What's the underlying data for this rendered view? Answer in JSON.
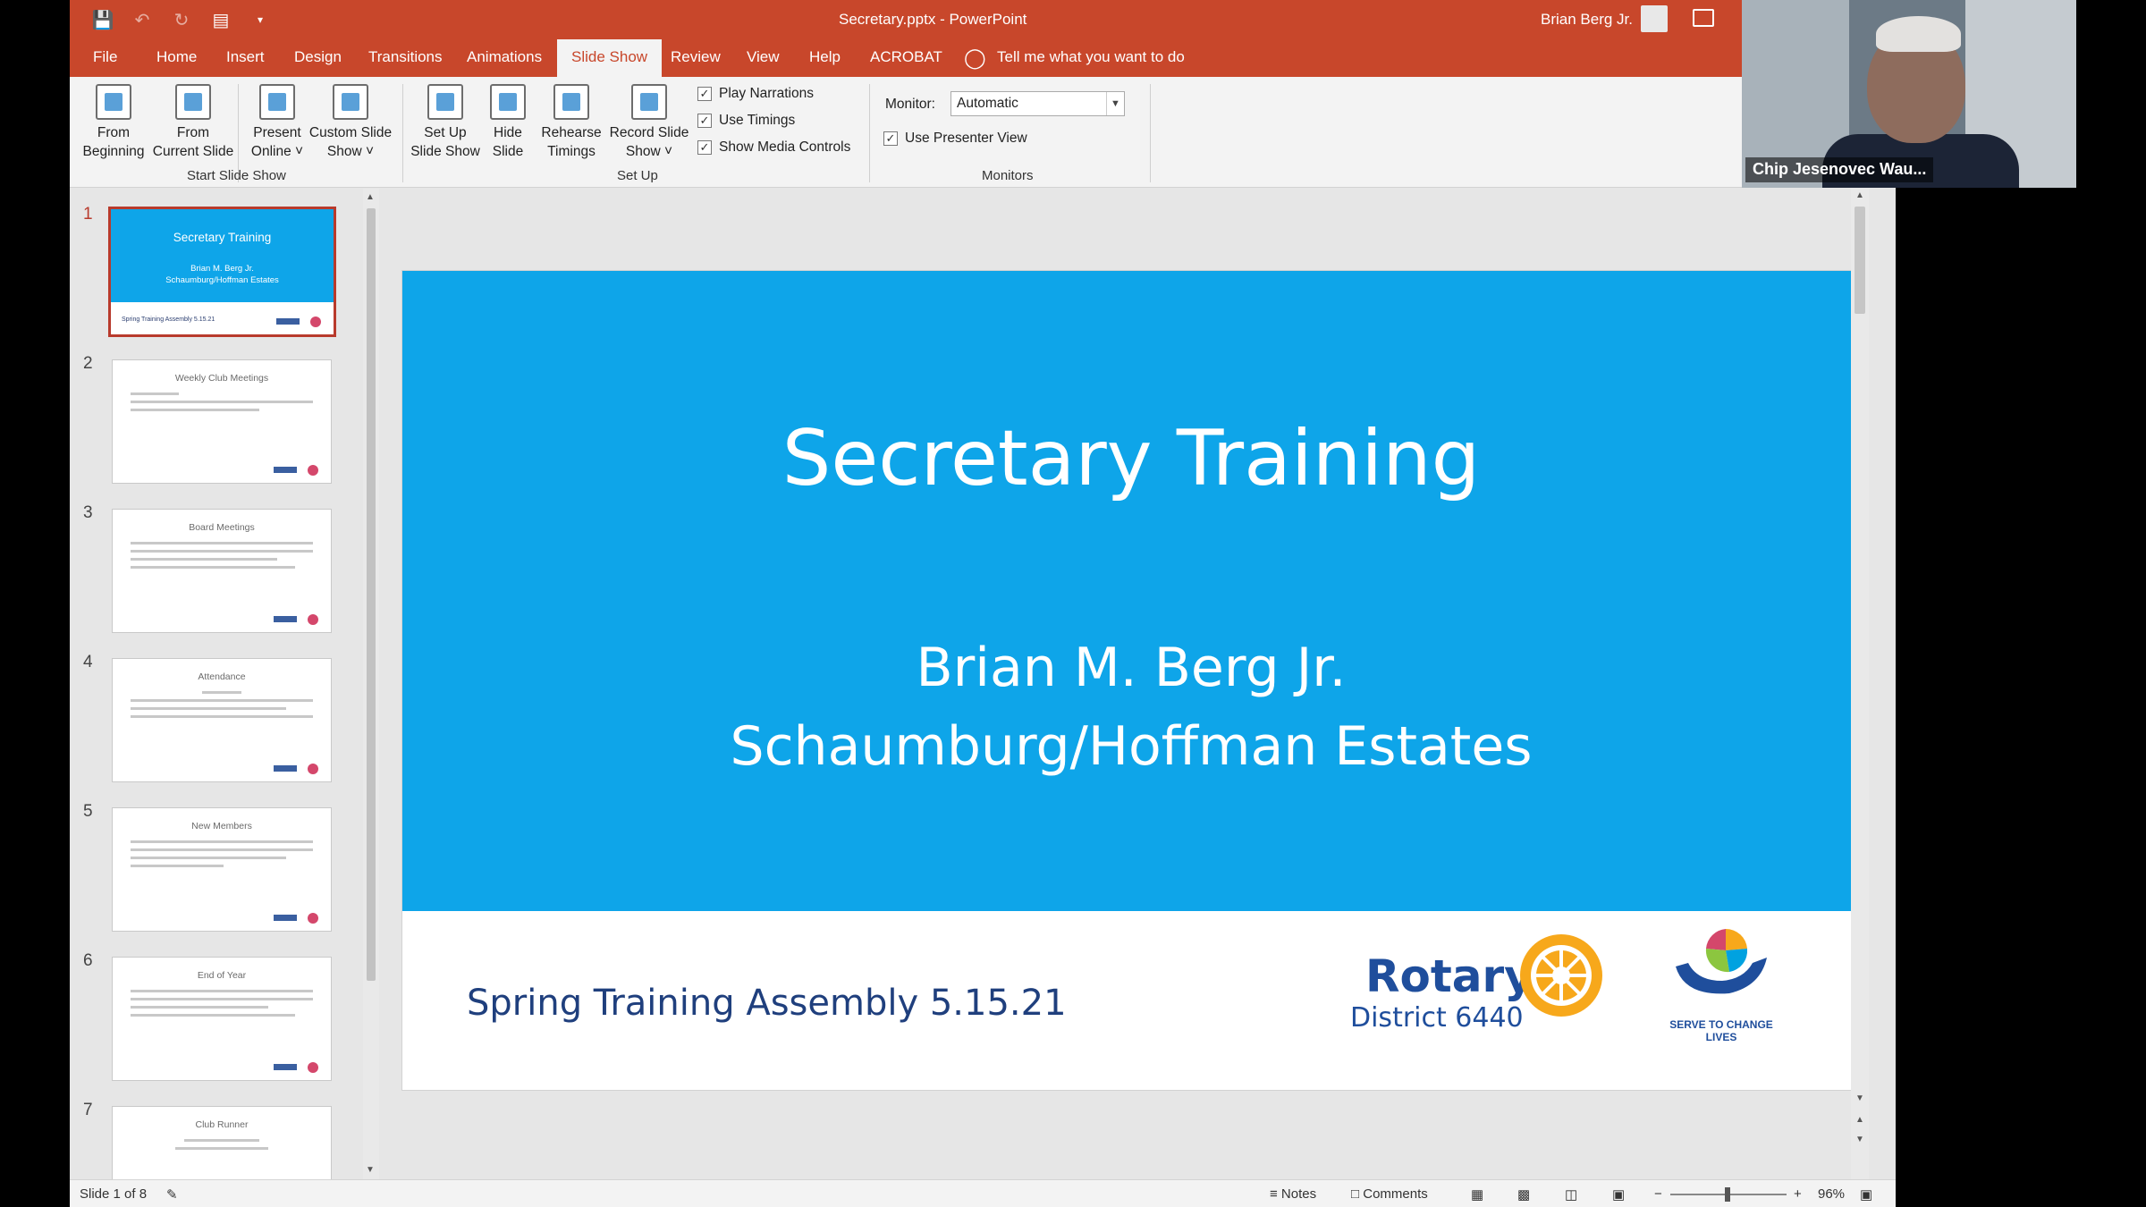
{
  "titlebar": {
    "doc_title": "Secretary.pptx  -  PowerPoint",
    "user_name": "Brian Berg Jr."
  },
  "tabs": [
    "File",
    "Home",
    "Insert",
    "Design",
    "Transitions",
    "Animations",
    "Slide Show",
    "Review",
    "View",
    "Help",
    "ACROBAT"
  ],
  "active_tab": "Slide Show",
  "tell_me": "Tell me what you want to do",
  "ribbon": {
    "from_beginning": "From Beginning",
    "from_current": "From Current Slide",
    "present_online": "Present Online ˅",
    "custom_show": "Custom Slide Show ˅",
    "start_group": "Start Slide Show",
    "setup_show": "Set Up Slide Show",
    "hide_slide": "Hide Slide",
    "rehearse": "Rehearse Timings",
    "record": "Record Slide Show ˅",
    "play_narrations": "Play Narrations",
    "use_timings": "Use Timings",
    "show_media": "Show Media Controls",
    "setup_group": "Set Up",
    "monitor_label": "Monitor:",
    "monitor_value": "Automatic",
    "presenter_view": "Use Presenter View",
    "monitors_group": "Monitors"
  },
  "thumbnails": [
    {
      "num": "1",
      "title": "Secretary Training",
      "sub1": "Brian M. Berg Jr.",
      "sub2": "Schaumburg/Hoffman Estates",
      "foot": "Spring Training Assembly 5.15.21"
    },
    {
      "num": "2",
      "title": "Weekly Club Meetings"
    },
    {
      "num": "3",
      "title": "Board Meetings"
    },
    {
      "num": "4",
      "title": "Attendance"
    },
    {
      "num": "5",
      "title": "New Members"
    },
    {
      "num": "6",
      "title": "End of Year"
    },
    {
      "num": "7",
      "title": "Club Runner"
    }
  ],
  "slide": {
    "title": "Secretary Training",
    "subtitle_line1": "Brian M. Berg Jr.",
    "subtitle_line2": "Schaumburg/Hoffman Estates",
    "footer": "Spring Training Assembly 5.15.21",
    "rotary": "Rotary",
    "district": "District 6440",
    "serve": "SERVE TO CHANGE LIVES"
  },
  "status": {
    "slide_counter": "Slide 1 of 8",
    "notes": "Notes",
    "comments": "Comments",
    "zoom": "96%"
  },
  "video": {
    "participant": "Chip Jesenovec Wau..."
  },
  "colors": {
    "accent": "#c8472b",
    "slide_blue": "#0ea5e9",
    "rotary_blue": "#1f4e9c"
  }
}
